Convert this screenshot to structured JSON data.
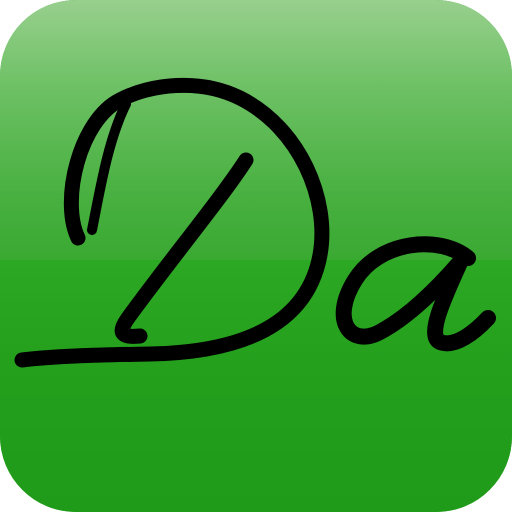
{
  "icon": {
    "letters": "Da",
    "colors": {
      "gloss_light": "#98cf8e",
      "gloss_mid": "#48b040",
      "base_green": "#23a11f",
      "letter_color": "#000000"
    }
  }
}
